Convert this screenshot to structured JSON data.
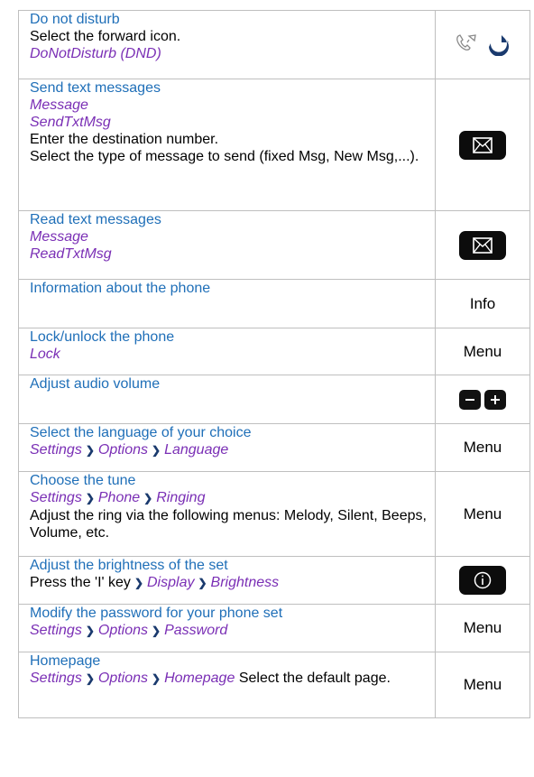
{
  "rows": [
    {
      "title": "Do not disturb",
      "l1": "Select the forward icon.",
      "p1": "DoNotDisturb (DND)",
      "icon": "forward-icon"
    },
    {
      "title": "Send text messages",
      "p1": "Message",
      "p2": "SendTxtMsg",
      "l1": "Enter the destination number.",
      "l2": "Select the type of message to send (fixed Msg, New Msg,...).",
      "icon": "envelope-icon"
    },
    {
      "title": "Read text messages",
      "p1": "Message",
      "p2": "ReadTxtMsg",
      "icon": "envelope-icon"
    },
    {
      "title": "Information about the phone",
      "right": "Info"
    },
    {
      "title": "Lock/unlock the phone",
      "p1": "Lock",
      "right": "Menu"
    },
    {
      "title": "Adjust audio volume",
      "icon": "volume-keys"
    },
    {
      "title": "Select the language of your choice",
      "path": [
        "Settings",
        "Options",
        "Language"
      ],
      "right": "Menu"
    },
    {
      "title": "Choose the tune",
      "path": [
        "Settings",
        "Phone",
        "Ringing"
      ],
      "l1": "Adjust the ring via the following menus: Melody, Silent, Beeps, Volume, etc.",
      "right": "Menu"
    },
    {
      "title": "Adjust the brightness of the set",
      "lead": "Press the 'I' key",
      "path": [
        "Display",
        "Brightness"
      ],
      "icon": "info-key-icon"
    },
    {
      "title": "Modify the password for your phone set",
      "path": [
        "Settings",
        "Options",
        "Password"
      ],
      "right": "Menu"
    },
    {
      "title": "Homepage",
      "path": [
        "Settings",
        "Options",
        "Homepage"
      ],
      "tail": "Select the default page.",
      "right": "Menu"
    }
  ]
}
